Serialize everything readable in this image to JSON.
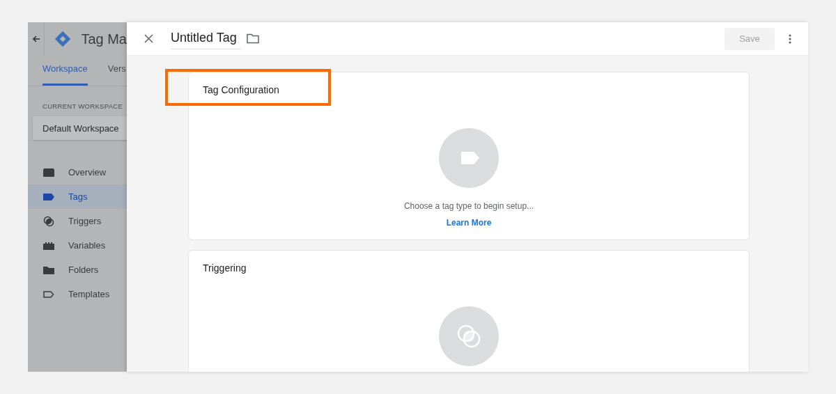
{
  "sidebar": {
    "app_title": "Tag Ma",
    "tabs": [
      {
        "label": "Workspace",
        "selected": true
      },
      {
        "label": "Vers",
        "selected": false
      }
    ],
    "workspace_label": "CURRENT WORKSPACE",
    "workspace_name": "Default Workspace",
    "nav": [
      {
        "label": "Overview",
        "kind": "overview",
        "selected": false
      },
      {
        "label": "Tags",
        "kind": "tags",
        "selected": true
      },
      {
        "label": "Triggers",
        "kind": "triggers",
        "selected": false
      },
      {
        "label": "Variables",
        "kind": "variables",
        "selected": false
      },
      {
        "label": "Folders",
        "kind": "folders",
        "selected": false
      },
      {
        "label": "Templates",
        "kind": "templates",
        "selected": false
      }
    ]
  },
  "editor": {
    "title": "Untitled Tag",
    "save_button": "Save",
    "save_disabled": true,
    "cards": [
      {
        "kind": "tag",
        "title": "Tag Configuration",
        "highlighted": true,
        "hint": "Choose a tag type to begin setup...",
        "link": "Learn More"
      },
      {
        "kind": "trigger",
        "title": "Triggering",
        "highlighted": false
      }
    ]
  }
}
